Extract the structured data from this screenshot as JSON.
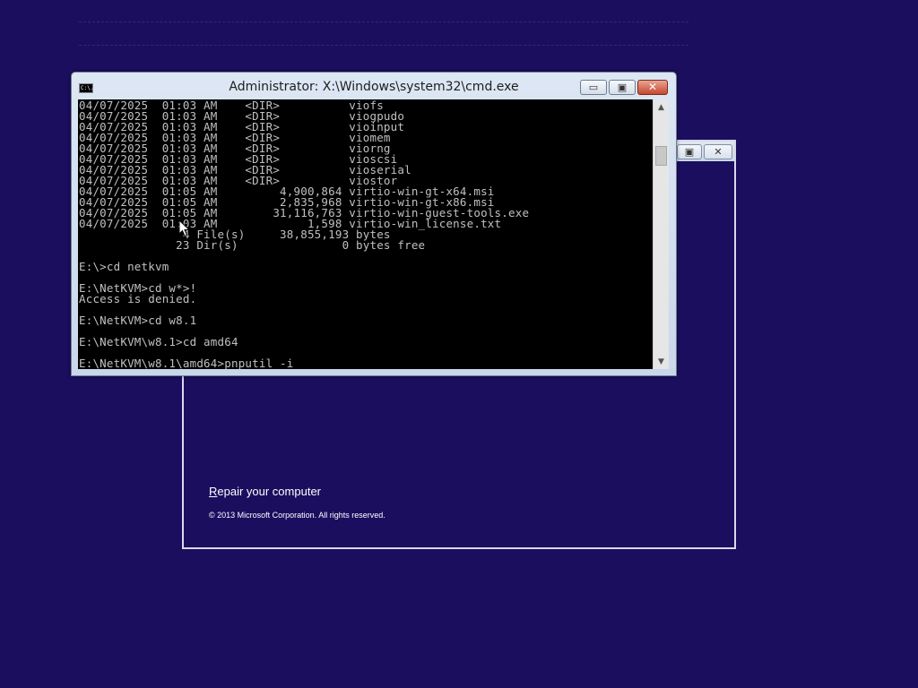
{
  "cmd_window": {
    "title": "Administrator: X:\\Windows\\system32\\cmd.exe",
    "icon_text": "C:\\.",
    "icon": "cmd-icon",
    "buttons": {
      "minimize": "▭",
      "maximize": "▣",
      "close": "✕"
    },
    "scroll_up": "▲",
    "scroll_down": "▼",
    "lines": [
      "04/07/2025  01:03 AM    <DIR>          viofs",
      "04/07/2025  01:03 AM    <DIR>          viogpudo",
      "04/07/2025  01:03 AM    <DIR>          vioinput",
      "04/07/2025  01:03 AM    <DIR>          viomem",
      "04/07/2025  01:03 AM    <DIR>          viorng",
      "04/07/2025  01:03 AM    <DIR>          vioscsi",
      "04/07/2025  01:03 AM    <DIR>          vioserial",
      "04/07/2025  01:03 AM    <DIR>          viostor",
      "04/07/2025  01:05 AM         4,900,864 virtio-win-gt-x64.msi",
      "04/07/2025  01:05 AM         2,835,968 virtio-win-gt-x86.msi",
      "04/07/2025  01:05 AM        31,116,763 virtio-win-guest-tools.exe",
      "04/07/2025  01:03 AM             1,598 virtio-win_license.txt",
      "               4 File(s)     38,855,193 bytes",
      "              23 Dir(s)               0 bytes free",
      "",
      "E:\\>cd netkvm",
      "",
      "E:\\NetKVM>cd w*>!",
      "Access is denied.",
      "",
      "E:\\NetKVM>cd w8.1",
      "",
      "E:\\NetKVM\\w8.1>cd amd64",
      "",
      "E:\\NetKVM\\w8.1\\amd64>pnputil -i"
    ]
  },
  "setup_window": {
    "buttons": {
      "restore": "▣",
      "close": "✕"
    },
    "repair_first_char": "R",
    "repair_rest": "epair your computer",
    "copyright": "© 2013 Microsoft Corporation. All rights reserved."
  },
  "colors": {
    "desktop_background": "#1b0e5f",
    "console_background": "#000000",
    "console_text": "#c0c0c0",
    "close_button": "#c6482f"
  }
}
